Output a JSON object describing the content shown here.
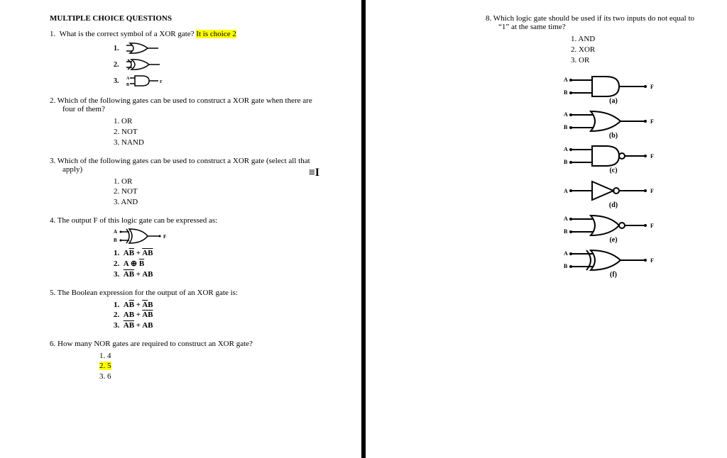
{
  "title": "MULTIPLE CHOICE QUESTIONS",
  "q1": {
    "num": "1.",
    "text": "What is the correct symbol of a XOR gate?",
    "hl": "It is choice 2",
    "opt1": "1.",
    "opt2": "2.",
    "opt3": "3."
  },
  "q2": {
    "text": "2. Which of the following gates can be used to construct a XOR gate when there are four of them?",
    "o1": "1.  OR",
    "o2": "2.  NOT",
    "o3": "3.  NAND"
  },
  "q3": {
    "text": "3. Which of the following gates can be used to construct a XOR gate (select all that apply)",
    "o1": "1.  OR",
    "o2": "2.  NOT",
    "o3": "3.  AND"
  },
  "q4": {
    "text": "4.  The output F of this logic gate can be expressed as:"
  },
  "q5": {
    "text": "5. The Boolean expression for the output of an XOR gate is:"
  },
  "q6": {
    "text": "6.  How many NOR gates are required to construct an XOR gate?",
    "o1": "1.  4",
    "o2": "2.  5",
    "o3": "3.  6"
  },
  "q8": {
    "text": "8.  Which logic gate should be used if its two inputs do not equal to “1” at the same time?",
    "o1": "1.  AND",
    "o2": "2.  XOR",
    "o3": "3.  OR"
  },
  "labels": {
    "a": "(a)",
    "b": "(b)",
    "c": "(c)",
    "d": "(d)",
    "e": "(e)",
    "f": "(f)"
  }
}
